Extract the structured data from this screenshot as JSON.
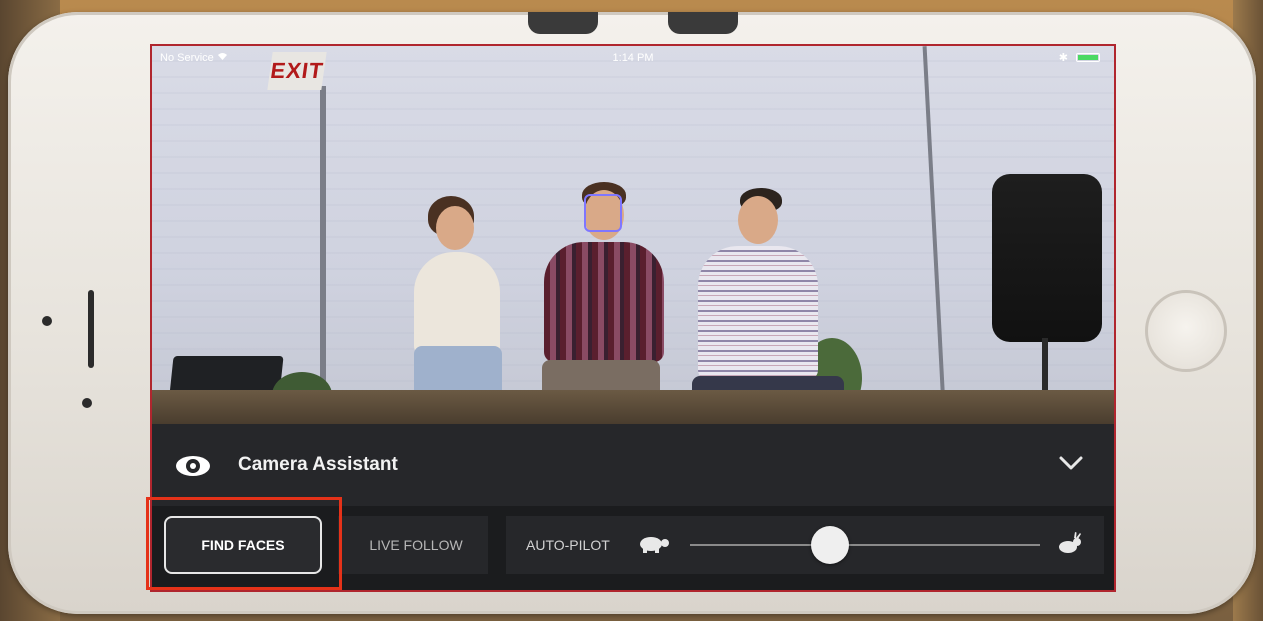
{
  "status_bar": {
    "carrier": "No Service",
    "time": "1:14 PM"
  },
  "camera_view": {
    "exit_sign": "EXIT"
  },
  "assistant": {
    "title": "Camera Assistant"
  },
  "controls": {
    "find_faces_label": "FIND FACES",
    "live_follow_label": "LIVE FOLLOW",
    "autopilot_label": "AUTO-PILOT",
    "speed_level": 0.4
  },
  "icons": {
    "assistant": "eye-icon",
    "collapse": "chevron-down-icon",
    "slow": "turtle-icon",
    "fast": "rabbit-icon",
    "wifi": "wifi-icon",
    "bluetooth": "bluetooth-icon",
    "battery": "battery-icon"
  },
  "colors": {
    "highlight": "#e53219",
    "face_box": "#7f76ff",
    "panel": "#202124",
    "battery": "#4cd964"
  }
}
